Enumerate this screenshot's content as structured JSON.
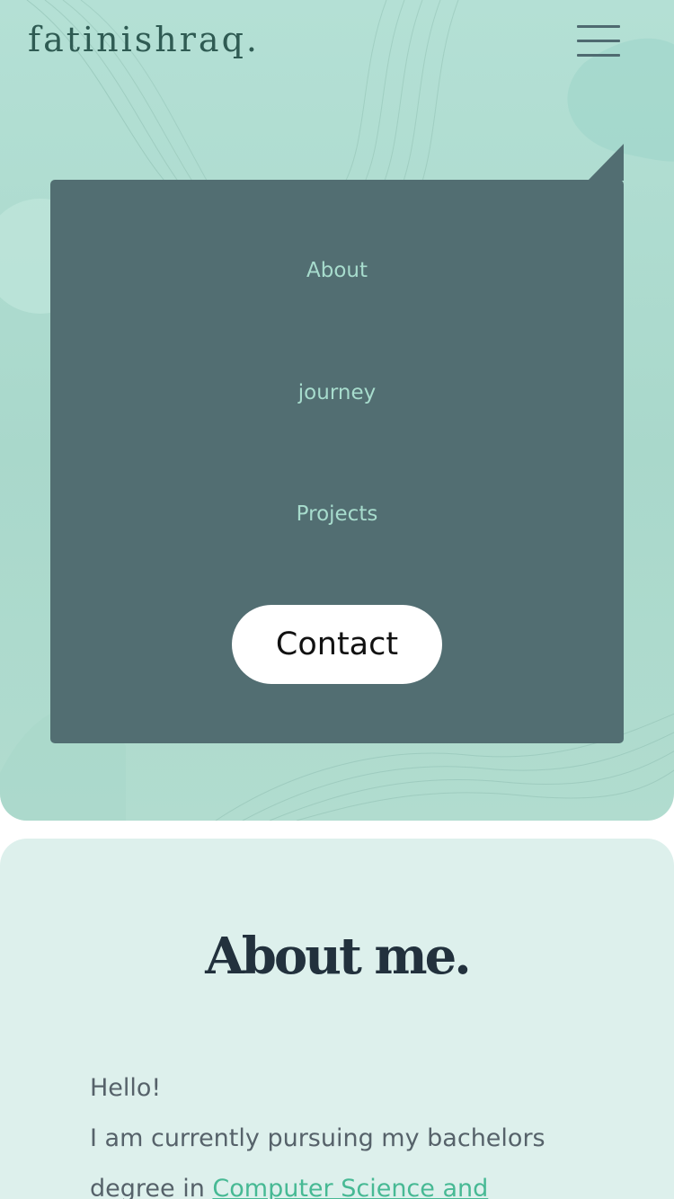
{
  "header": {
    "logo": "fatinishraq.",
    "menu_icon": "hamburger-menu-icon"
  },
  "nav": {
    "links": [
      {
        "label": "About"
      },
      {
        "label": "journey"
      },
      {
        "label": "Projects"
      }
    ],
    "contact_label": "Contact"
  },
  "about": {
    "title": "About me.",
    "greeting": "Hello!",
    "intro_text": "I am currently pursuing my bachelors degree in",
    "link_text": "Computer Science and"
  },
  "colors": {
    "hero_background": "#b4e0d5",
    "nav_panel": "#526e72",
    "nav_link": "#a7dccd",
    "about_background": "#ddf0ec",
    "heading": "#22313d",
    "body_text": "#56626a",
    "link": "#47b994"
  }
}
